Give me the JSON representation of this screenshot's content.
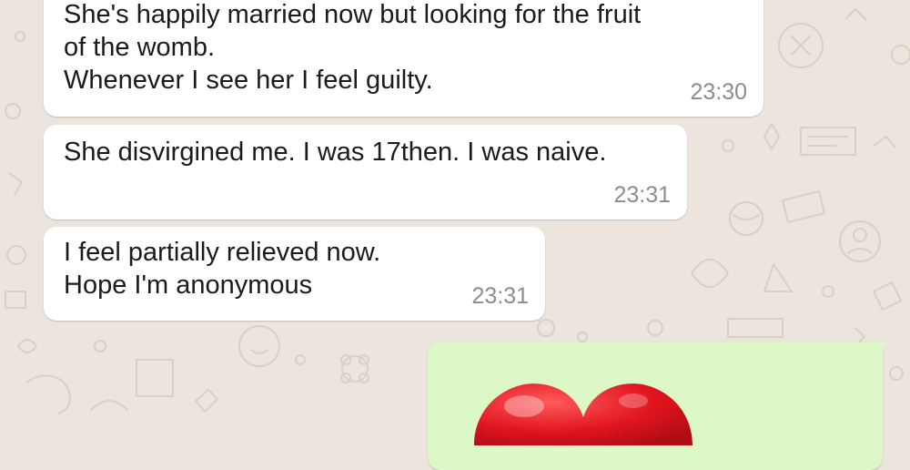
{
  "messages": [
    {
      "lines": [
        "She's happily married now but looking for the fruit",
        "of the womb.",
        "Whenever I see her I feel guilty."
      ],
      "time": "23:30"
    },
    {
      "lines": [
        "She disvirgined me. I was 17then. I was naive."
      ],
      "time": "23:31"
    },
    {
      "lines": [
        "I feel partially relieved now.",
        "Hope I'm anonymous"
      ],
      "time": "23:31"
    }
  ],
  "outgoing": {
    "content": "heart-emoji"
  },
  "colors": {
    "background": "#ece5dd",
    "incoming_bubble": "#ffffff",
    "outgoing_bubble": "#dcf8c6",
    "timestamp": "#8a8d8f",
    "heart": "#e0141e"
  }
}
